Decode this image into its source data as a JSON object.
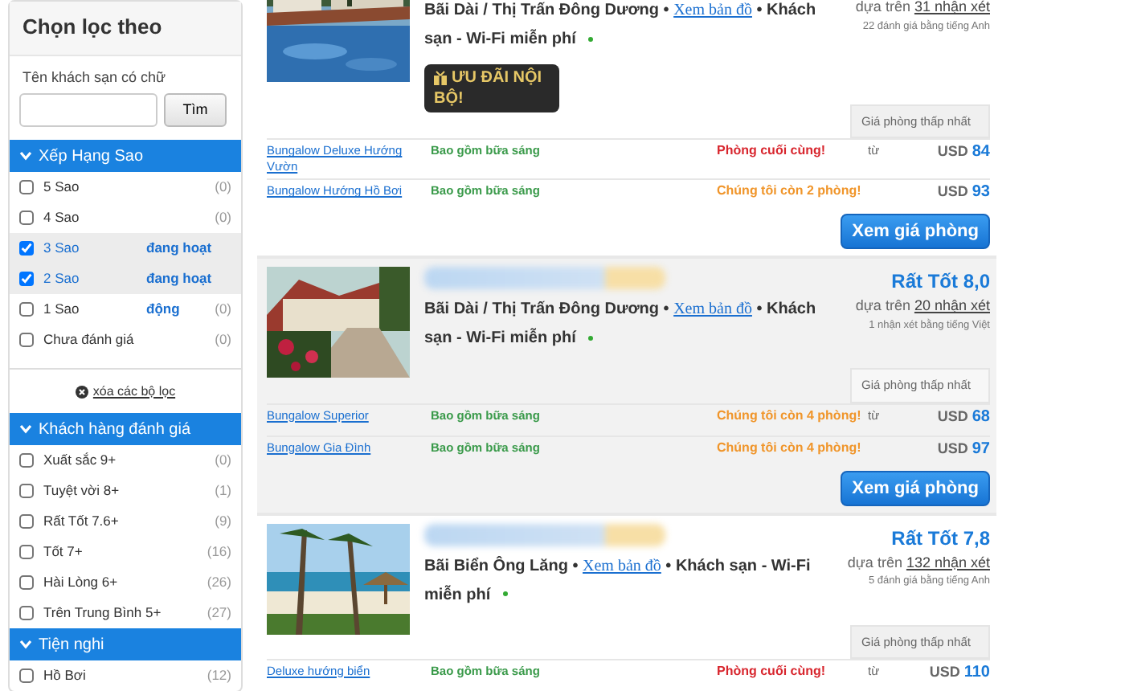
{
  "sidebar": {
    "title": "Chọn lọc theo",
    "search": {
      "label": "Tên khách sạn có chữ",
      "button": "Tìm"
    },
    "sections": [
      {
        "title": "Xếp Hạng Sao",
        "expanded": true,
        "items": [
          {
            "label": "5 Sao",
            "count": "(0)",
            "checked": false
          },
          {
            "label": "4 Sao",
            "count": "(0)",
            "checked": false
          },
          {
            "label": "3 Sao",
            "status": "đang hoạt",
            "checked": true
          },
          {
            "label": "2 Sao",
            "status": "đang hoạt động",
            "checked": true
          },
          {
            "label": "1 Sao",
            "count": "(0)",
            "checked": false
          },
          {
            "label": "Chưa đánh giá",
            "count": "(0)",
            "checked": false
          }
        ],
        "clear_filters": "xóa các bộ lọc"
      },
      {
        "title": "Khách hàng đánh giá",
        "expanded": true,
        "items": [
          {
            "label": "Xuất sắc 9+",
            "count": "(0)",
            "checked": false
          },
          {
            "label": "Tuyệt vời 8+",
            "count": "(1)",
            "checked": false
          },
          {
            "label": "Rất Tốt 7.6+",
            "count": "(9)",
            "checked": false
          },
          {
            "label": "Tốt 7+",
            "count": "(16)",
            "checked": false
          },
          {
            "label": "Hài Lòng 6+",
            "count": "(26)",
            "checked": false
          },
          {
            "label": "Trên Trung Bình 5+",
            "count": "(27)",
            "checked": false
          }
        ]
      },
      {
        "title": "Tiện nghi",
        "expanded": true,
        "items": [
          {
            "label": "Hồ Bơi",
            "count": "(12)",
            "checked": false
          }
        ]
      }
    ]
  },
  "hotels": [
    {
      "highlighted": false,
      "image": {
        "kind": "picture"
      },
      "location": "Bãi Dài / Thị Trấn Đông Dương",
      "separators": [
        "•",
        "•"
      ],
      "map_link": "Xem bản đồ",
      "type": "Khách sạn - Wi-Fi miễn phí",
      "reviews_prefix": "dựa trên",
      "reviews_link": "31 nhận xét",
      "review_note": "22 đánh giá bằng tiếng Anh",
      "badge": "ƯU ĐÃI NỘI BỘ!",
      "price_label": "Giá phòng thấp nhất",
      "rooms": [
        {
          "name": "Bungalow Deluxe Hướng Vườn",
          "breakfast": "Bao gồm bữa sáng",
          "availability": "Phòng cuối cùng!",
          "color": "#d8262e",
          "from": "từ",
          "currency": "USD",
          "price": "84"
        },
        {
          "name": "Bungalow Hướng Hồ Bơi",
          "breakfast": "Bao gồm bữa sáng",
          "availability": "Chúng tôi còn 2 phòng!",
          "color": "#f0952a",
          "currency": "USD",
          "price": "93"
        }
      ],
      "button": "Xem giá phòng"
    },
    {
      "highlighted": true,
      "image": {
        "kind": "picture"
      },
      "rating": "Rất Tốt 8,0",
      "location": "Bãi Dài / Thị Trấn Đông Dương",
      "separators": [
        "•",
        "•"
      ],
      "map_link": "Xem bản đồ",
      "type": "Khách sạn - Wi-Fi miễn phí",
      "reviews_prefix": "dựa trên",
      "reviews_link": "20 nhận xét",
      "review_note": "1 nhận xét bằng tiếng Việt",
      "price_label": "Giá phòng thấp nhất",
      "rooms": [
        {
          "name": "Bungalow Superior",
          "breakfast": "Bao gồm bữa sáng",
          "availability": "Chúng tôi còn 4 phòng!",
          "color": "#f0952a",
          "from": "từ",
          "currency": "USD",
          "price": "68"
        },
        {
          "name": "Bungalow Gia Đình",
          "breakfast": "Bao gồm bữa sáng",
          "availability": "Chúng tôi còn 4 phòng!",
          "color": "#f0952a",
          "currency": "USD",
          "price": "97"
        }
      ],
      "button": "Xem giá phòng"
    },
    {
      "highlighted": false,
      "image": {
        "kind": "picture"
      },
      "rating": "Rất Tốt 7,8",
      "location": "Bãi Biển Ông Lăng",
      "separators": [
        "•",
        "•"
      ],
      "map_link": "Xem bản đồ",
      "type": "Khách sạn - Wi-Fi miễn phí",
      "reviews_prefix": "dựa trên",
      "reviews_link": "132 nhận xét",
      "review_note": "5 đánh giá bằng tiếng Anh",
      "price_label": "Giá phòng thấp nhất",
      "rooms": [
        {
          "name": "Deluxe hướng biển",
          "breakfast": "Bao gồm bữa sáng",
          "availability": "Phòng cuối cùng!",
          "color": "#d8262e",
          "from": "từ",
          "currency": "USD",
          "price": "110"
        }
      ]
    }
  ]
}
